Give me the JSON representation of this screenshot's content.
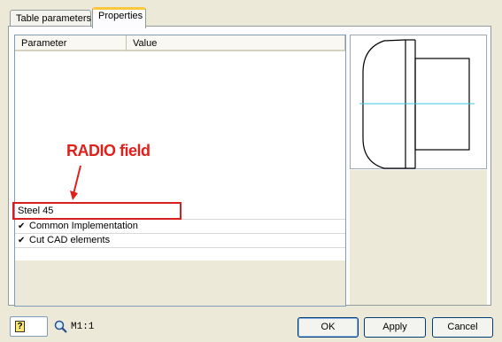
{
  "tabs": [
    {
      "label": "Table parameters",
      "active": false
    },
    {
      "label": "Properties",
      "active": true
    }
  ],
  "list": {
    "columns": {
      "parameter": "Parameter",
      "value": "Value"
    },
    "radio_value": "Steel 45",
    "checks": [
      {
        "label": "Common Implementation",
        "checked": true
      },
      {
        "label": "Cut CAD elements",
        "checked": true
      }
    ]
  },
  "annotation": {
    "label": "RADIO field",
    "color": "#e0201c"
  },
  "statusbar": {
    "zoom": "M1:1"
  },
  "buttons": {
    "ok": "OK",
    "apply": "Apply",
    "cancel": "Cancel"
  },
  "preview": {
    "axis_color": "#3ec8dc"
  }
}
